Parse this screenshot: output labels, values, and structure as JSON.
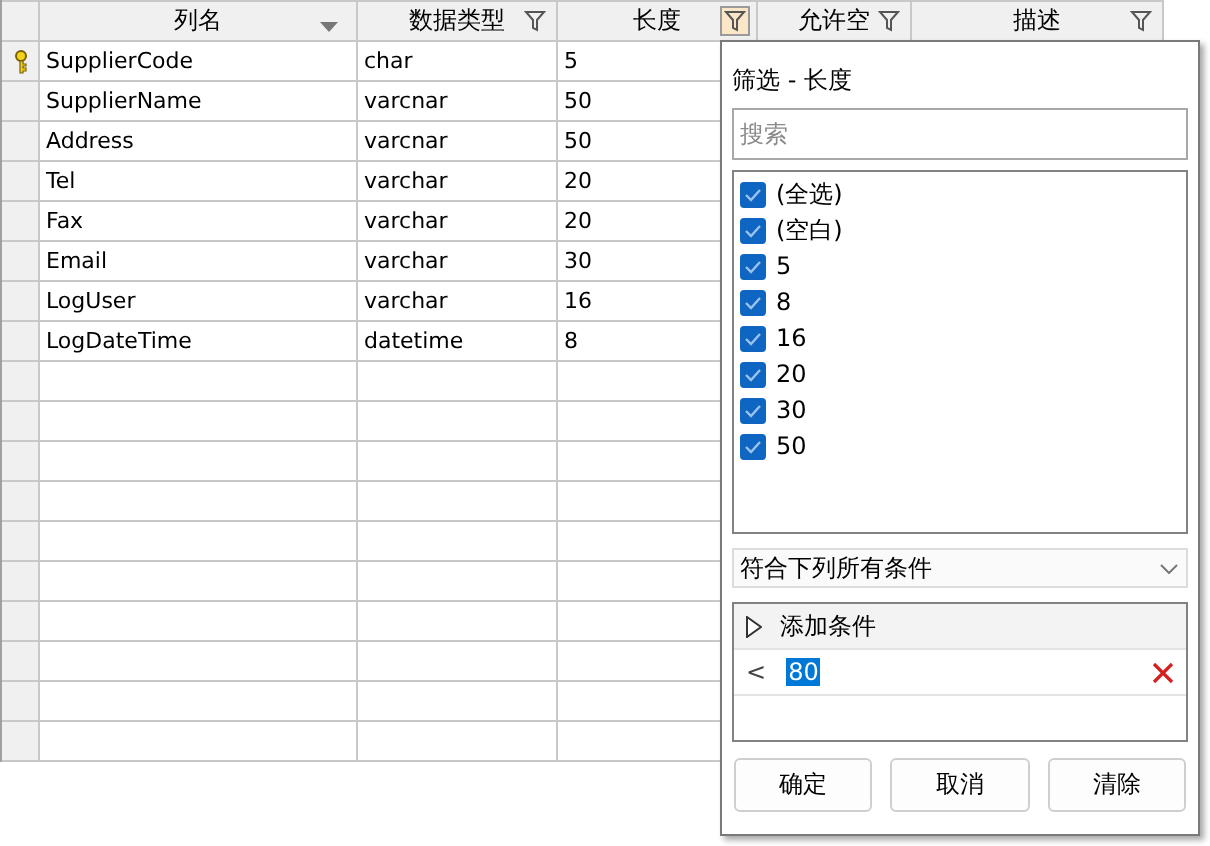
{
  "columns": [
    {
      "label": "列名",
      "kind": "sort",
      "active": false
    },
    {
      "label": "数据类型",
      "kind": "filter",
      "active": false
    },
    {
      "label": "长度",
      "kind": "filter",
      "active": true
    },
    {
      "label": "允许空",
      "kind": "filter",
      "active": false
    },
    {
      "label": "描述",
      "kind": "filter",
      "active": false
    }
  ],
  "rows": [
    {
      "primary_key": true,
      "cells": [
        "SupplierCode",
        "char",
        "5"
      ]
    },
    {
      "primary_key": false,
      "cells": [
        "SupplierName",
        "varcnar",
        "50"
      ]
    },
    {
      "primary_key": false,
      "cells": [
        "Address",
        "varcnar",
        "50"
      ]
    },
    {
      "primary_key": false,
      "cells": [
        "Tel",
        "varchar",
        "20"
      ]
    },
    {
      "primary_key": false,
      "cells": [
        "Fax",
        "varchar",
        "20"
      ]
    },
    {
      "primary_key": false,
      "cells": [
        "Email",
        "varchar",
        "30"
      ]
    },
    {
      "primary_key": false,
      "cells": [
        "LogUser",
        "varchar",
        "16"
      ]
    },
    {
      "primary_key": false,
      "cells": [
        "LogDateTime",
        "datetime",
        "8"
      ]
    }
  ],
  "filter_popup": {
    "title": "筛选 - 长度",
    "search": {
      "placeholder": "搜索"
    },
    "values": [
      {
        "label": "(全选)",
        "checked": true
      },
      {
        "label": "(空白)",
        "checked": true
      },
      {
        "label": "5",
        "checked": true
      },
      {
        "label": "8",
        "checked": true
      },
      {
        "label": "16",
        "checked": true
      },
      {
        "label": "20",
        "checked": true
      },
      {
        "label": "30",
        "checked": true
      },
      {
        "label": "50",
        "checked": true
      }
    ],
    "match_mode": "符合下列所有条件",
    "add_condition": "添加条件",
    "conditions": [
      {
        "operator": "<",
        "value": "80",
        "selected": true
      }
    ],
    "buttons": [
      "确定",
      "取消",
      "清除"
    ]
  }
}
